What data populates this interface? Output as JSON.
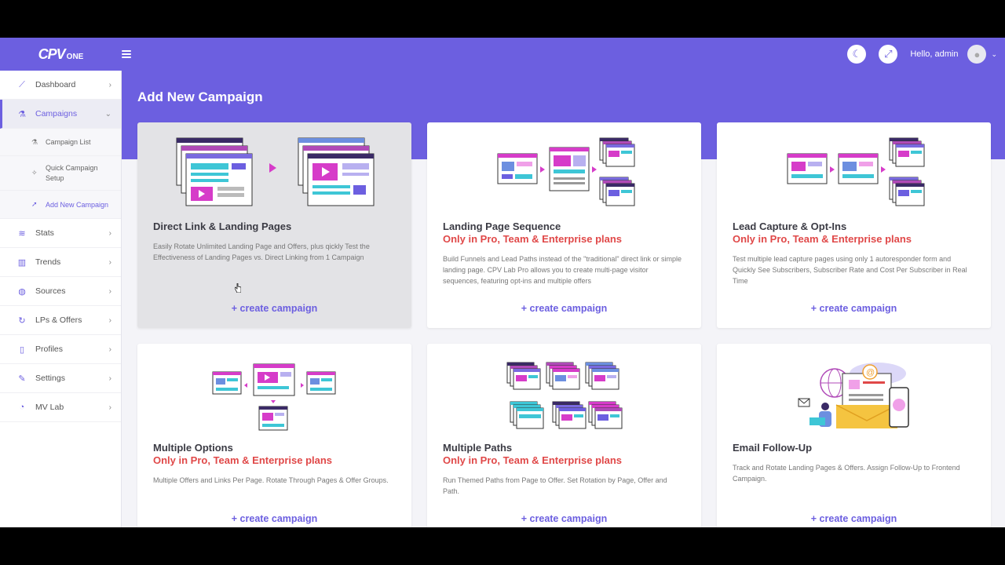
{
  "app": {
    "logo_main": "CPV",
    "logo_sub": "ONE"
  },
  "header": {
    "greeting": "Hello, admin",
    "theme_icon": "moon-icon",
    "fullscreen_icon": "expand-icon"
  },
  "sidebar": {
    "items": [
      {
        "label": "Dashboard",
        "icon": "chart-line-icon"
      },
      {
        "label": "Campaigns",
        "icon": "flask-icon"
      },
      {
        "label": "Stats",
        "icon": "stats-icon"
      },
      {
        "label": "Trends",
        "icon": "columns-icon"
      },
      {
        "label": "Sources",
        "icon": "globe-icon"
      },
      {
        "label": "LPs & Offers",
        "icon": "redo-icon"
      },
      {
        "label": "Profiles",
        "icon": "clipboard-icon"
      },
      {
        "label": "Settings",
        "icon": "wrench-icon"
      },
      {
        "label": "MV Lab",
        "icon": "vial-icon"
      }
    ],
    "campaign_subitems": [
      {
        "label": "Campaign List"
      },
      {
        "label": "Quick Campaign Setup"
      },
      {
        "label": "Add New Campaign"
      }
    ]
  },
  "page": {
    "title": "Add New Campaign"
  },
  "cards": [
    {
      "title": "Direct Link & Landing Pages",
      "plan": "",
      "desc": "Easily Rotate Unlimited Landing Page and Offers, plus qickly Test the Effectiveness of Landing Pages vs. Direct Linking from 1 Campaign",
      "cta": "+ create campaign"
    },
    {
      "title": "Landing Page Sequence",
      "plan": "Only in Pro, Team & Enterprise plans",
      "desc": "Build Funnels and Lead Paths instead of the \"traditional\" direct link or simple landing page. CPV Lab Pro allows you to create multi-page visitor sequences, featuring opt-ins and multiple offers",
      "cta": "+ create campaign"
    },
    {
      "title": "Lead Capture & Opt-Ins",
      "plan": "Only in Pro, Team & Enterprise plans",
      "desc": "Test multiple lead capture pages using only 1 autoresponder form and Quickly See Subscribers, Subscriber Rate and Cost Per Subscriber in Real Time",
      "cta": "+ create campaign"
    },
    {
      "title": "Multiple Options",
      "plan": "Only in Pro, Team & Enterprise plans",
      "desc": "Multiple Offers and Links Per Page. Rotate Through Pages & Offer Groups.",
      "cta": "+ create campaign"
    },
    {
      "title": "Multiple Paths",
      "plan": "Only in Pro, Team & Enterprise plans",
      "desc": "Run Themed Paths from Page to Offer. Set Rotation by Page, Offer and Path.",
      "cta": "+ create campaign"
    },
    {
      "title": "Email Follow-Up",
      "plan": "",
      "desc": "Track and Rotate Landing Pages & Offers. Assign Follow-Up to Frontend Campaign.",
      "cta": "+ create campaign"
    }
  ],
  "colors": {
    "brand": "#6c5fe0",
    "plan_red": "#e04848",
    "accent_pink": "#d63cc9",
    "accent_teal": "#3ec6d6"
  }
}
